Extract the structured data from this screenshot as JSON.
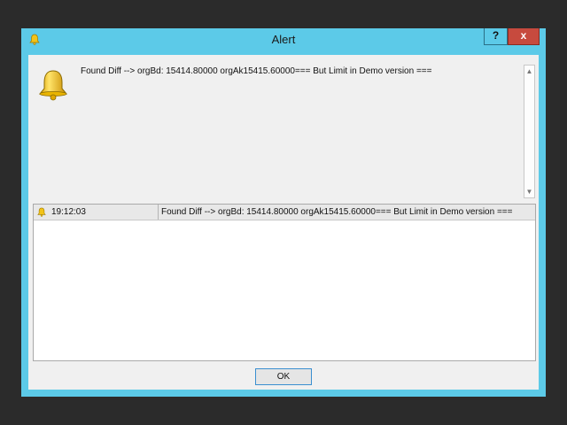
{
  "window": {
    "title": "Alert",
    "help_label": "?",
    "close_label": "x"
  },
  "alert": {
    "message": "Found Diff --> orgBd: 15414.80000 orgAk15415.60000=== But Limit in Demo version ==="
  },
  "log": {
    "rows": [
      {
        "time": "19:12:03",
        "message": "Found Diff --> orgBd: 15414.80000 orgAk15415.60000=== But Limit in Demo version ==="
      }
    ]
  },
  "buttons": {
    "ok_label": "OK"
  },
  "colors": {
    "titlebar": "#5ccae8",
    "close_button": "#c74a3e",
    "client_bg": "#f0f0f0",
    "bell": "#f2c318"
  },
  "icons": {
    "title": "bell-icon",
    "alert": "bell-icon",
    "row": "bell-icon",
    "scroll_up": "chevron-up-icon",
    "scroll_down": "chevron-down-icon"
  }
}
